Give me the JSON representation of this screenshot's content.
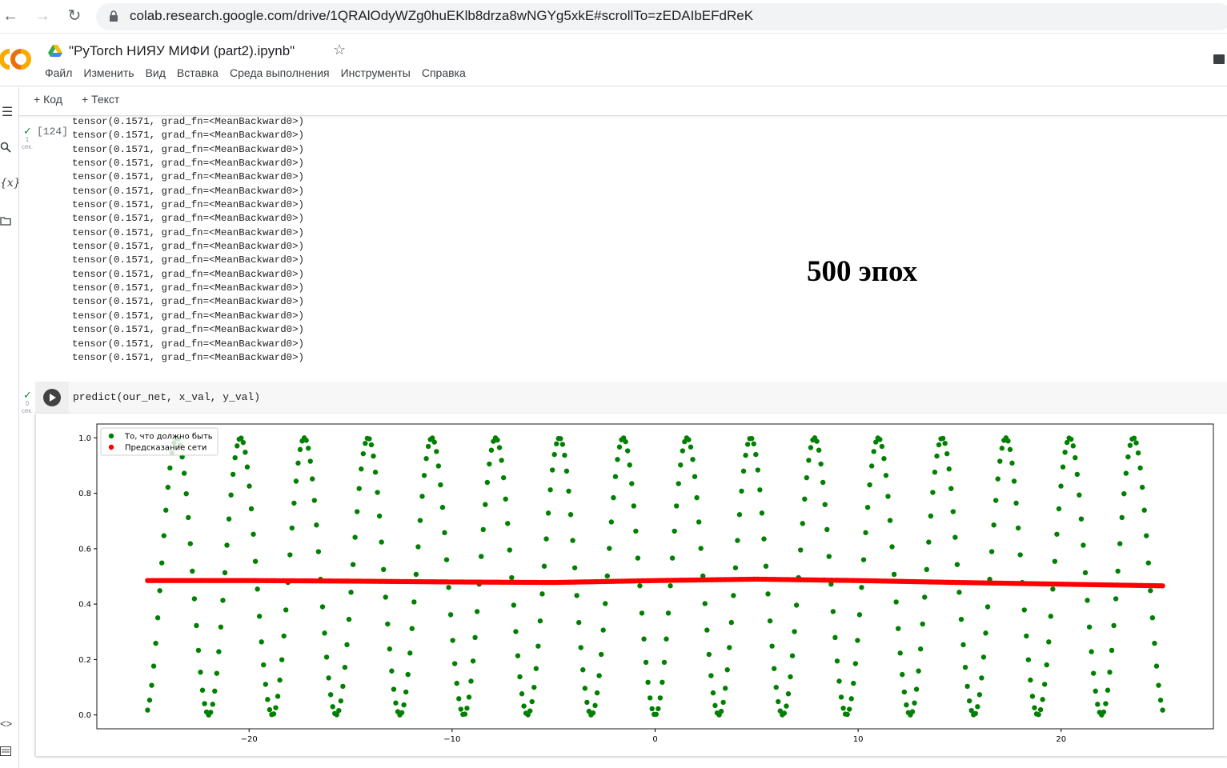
{
  "browser": {
    "url": "colab.research.google.com/drive/1QRAlOdyWZg0huEKlb8drza8wNGYg5xkE#scrollTo=zEDAIbEFdReK"
  },
  "notebook": {
    "title": "\"PyTorch  НИЯУ МИФИ (part2).ipynb\"",
    "menu": [
      "Файл",
      "Изменить",
      "Вид",
      "Вставка",
      "Среда выполнения",
      "Инструменты",
      "Справка"
    ],
    "toolbar": {
      "code_label": "+ Код",
      "text_label": "+ Текст"
    }
  },
  "cells": {
    "output_cell": {
      "exec_count": "[124]",
      "time_value": "1",
      "time_unit": "сек.",
      "lines": [
        "tensor(0.1571, grad_fn=<MeanBackward0>)",
        "tensor(0.1571, grad_fn=<MeanBackward0>)",
        "tensor(0.1571, grad_fn=<MeanBackward0>)",
        "tensor(0.1571, grad_fn=<MeanBackward0>)",
        "tensor(0.1571, grad_fn=<MeanBackward0>)",
        "tensor(0.1571, grad_fn=<MeanBackward0>)",
        "tensor(0.1571, grad_fn=<MeanBackward0>)",
        "tensor(0.1571, grad_fn=<MeanBackward0>)",
        "tensor(0.1571, grad_fn=<MeanBackward0>)",
        "tensor(0.1571, grad_fn=<MeanBackward0>)",
        "tensor(0.1571, grad_fn=<MeanBackward0>)",
        "tensor(0.1571, grad_fn=<MeanBackward0>)",
        "tensor(0.1571, grad_fn=<MeanBackward0>)",
        "tensor(0.1571, grad_fn=<MeanBackward0>)",
        "tensor(0.1571, grad_fn=<MeanBackward0>)",
        "tensor(0.1571, grad_fn=<MeanBackward0>)",
        "tensor(0.1571, grad_fn=<MeanBackward0>)",
        "tensor(0.1571, grad_fn=<MeanBackward0>)"
      ]
    },
    "code_cell": {
      "code": "predict(our_net, x_val, y_val)",
      "time_value": "0",
      "time_unit": "сек."
    }
  },
  "annotation": "500 эпох",
  "icons": {
    "back": "back-arrow-icon",
    "forward": "forward-arrow-icon",
    "reload": "reload-icon",
    "lock": "lock-icon",
    "logo": "colab-logo",
    "drive": "drive-icon",
    "star": "star-icon",
    "comment": "comment-icon",
    "toc": "table-of-contents-icon",
    "search": "search-icon",
    "variables": "variables-icon",
    "files": "folder-icon",
    "code_snippets": "code-snippets-icon",
    "terminal": "terminal-icon",
    "run": "play-icon"
  },
  "chart_data": {
    "type": "scatter",
    "title": "",
    "xlabel": "",
    "ylabel": "",
    "xlim": [
      -27.5,
      27.5
    ],
    "ylim": [
      -0.05,
      1.05
    ],
    "xticks": [
      -20,
      -10,
      0,
      10,
      20
    ],
    "yticks": [
      0.0,
      0.2,
      0.4,
      0.6,
      0.8,
      1.0
    ],
    "grid": false,
    "legend_position": "top-left",
    "series": [
      {
        "name": "То, что должно быть",
        "color": "#008000",
        "function": "sin(x)^2",
        "x_range": [
          -25,
          25
        ],
        "n_points": 500
      },
      {
        "name": "Предсказание сети",
        "color": "#ff0000",
        "x_range": [
          -25,
          25
        ],
        "n_points": 500,
        "x": [
          -25,
          -20,
          -15,
          -10,
          -5,
          0,
          5,
          10,
          15,
          20,
          25
        ],
        "y": [
          0.485,
          0.485,
          0.483,
          0.48,
          0.478,
          0.485,
          0.49,
          0.485,
          0.478,
          0.472,
          0.466
        ]
      }
    ]
  }
}
